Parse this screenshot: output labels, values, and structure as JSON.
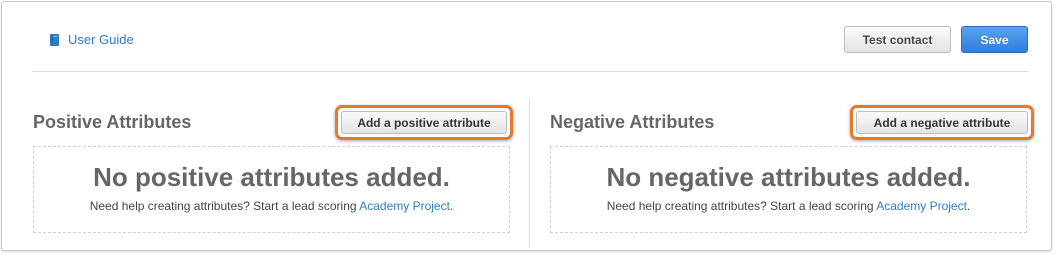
{
  "header": {
    "guide_link_label": "User Guide",
    "test_button_label": "Test contact",
    "save_button_label": "Save"
  },
  "positive": {
    "title": "Positive Attributes",
    "add_button_label": "Add a positive attribute",
    "empty_title": "No positive attributes added.",
    "help_text": "Need help creating attributes? Start a lead scoring",
    "link_label": "Academy Project",
    "period": "."
  },
  "negative": {
    "title": "Negative Attributes",
    "add_button_label": "Add a negative attribute",
    "empty_title": "No negative attributes added.",
    "help_text": "Need help creating attributes? Start a lead scoring",
    "link_label": "Academy Project",
    "period": "."
  },
  "colors": {
    "link": "#2e7cc4",
    "save_button": "#2f7ee0",
    "highlight_ring": "#e47a2e"
  },
  "icons": {
    "guide": "book-icon"
  }
}
